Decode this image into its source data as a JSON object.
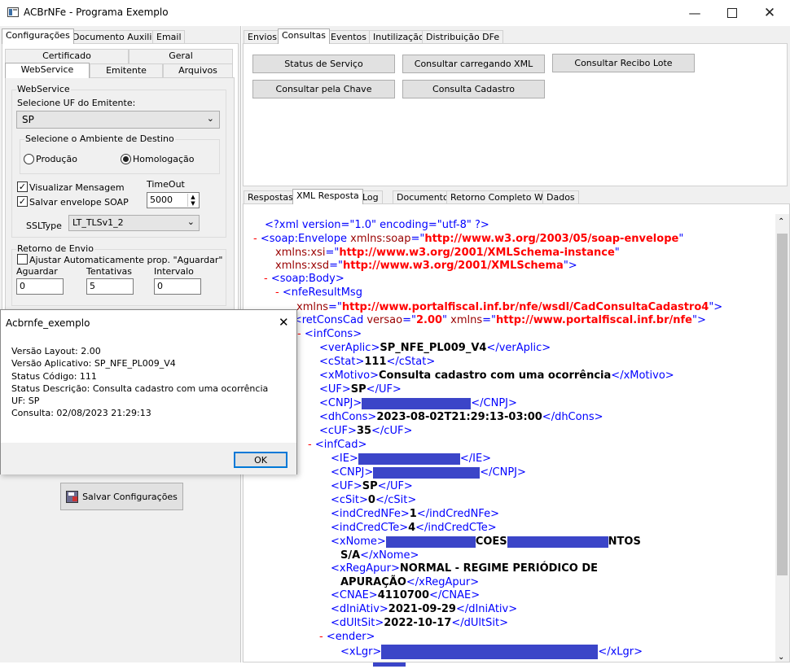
{
  "window": {
    "title": "ACBrNFe - Programa Exemplo"
  },
  "left_tabs": [
    "Configurações",
    "Documento Auxiliar",
    "Email"
  ],
  "sub_tabs_row1": [
    "Certificado",
    "Geral"
  ],
  "sub_tabs_row2": [
    "WebService",
    "Emitente",
    "Arquivos"
  ],
  "webservice": {
    "group_title": "WebService",
    "uf_label": "Selecione UF do Emitente:",
    "uf_value": "SP",
    "ambiente_title": "Selecione o Ambiente de Destino",
    "radio_producao": "Produção",
    "radio_homologacao": "Homologação",
    "chk_visualizar": "Visualizar Mensagem",
    "chk_salvar": "Salvar envelope SOAP",
    "timeout_label": "TimeOut",
    "timeout_value": "5000",
    "ssltype_label": "SSLType",
    "ssltype_value": "LT_TLSv1_2"
  },
  "retorno": {
    "group_title": "Retorno de Envio",
    "chk_ajustar": "Ajustar Automaticamente prop. \"Aguardar\"",
    "aguardar_label": "Aguardar",
    "aguardar_value": "0",
    "tentativas_label": "Tentativas",
    "tentativas_value": "5",
    "intervalo_label": "Intervalo",
    "intervalo_value": "0"
  },
  "save_button": "Salvar Configurações",
  "dialog": {
    "title": "Acbrnfe_exemplo",
    "lines": [
      "Versão Layout: 2.00",
      "Versão Aplicativo: SP_NFE_PL009_V4",
      "Status Código: 111",
      "Status Descrição: Consulta cadastro com uma ocorrência",
      "UF: SP",
      "Consulta: 02/08/2023 21:29:13"
    ],
    "ok": "OK"
  },
  "right_tabs": [
    "Envios",
    "Consultas",
    "Eventos",
    "Inutilização",
    "Distribuição DFe"
  ],
  "consultas_buttons": {
    "status": "Status de Serviço",
    "carregando_xml": "Consultar carregando XML",
    "recibo": "Consultar Recibo Lote",
    "chave": "Consultar pela Chave",
    "cadastro": "Consulta Cadastro"
  },
  "result_tabs": [
    "Respostas",
    "XML Resposta",
    "Log",
    "Documento",
    "Retorno Completo WS",
    "Dados"
  ],
  "xml": {
    "decl": "<?xml version=\"1.0\" encoding=\"utf-8\" ?>",
    "ns_soap": "http://www.w3.org/2003/05/soap-envelope",
    "ns_xsi": "http://www.w3.org/2001/XMLSchema-instance",
    "ns_xsd": "http://www.w3.org/2001/XMLSchema",
    "ns_wsdl": "http://www.portalfiscal.inf.br/nfe/wsdl/CadConsultaCadastro4",
    "versao": "2.00",
    "ns_nfe": "http://www.portalfiscal.inf.br/nfe",
    "verAplic": "SP_NFE_PL009_V4",
    "cStat": "111",
    "xMotivo": "Consulta cadastro com uma ocorrência",
    "uf": "SP",
    "dhCons": "2023-08-02T21:29:13-03:00",
    "cUF": "35",
    "sit": "0",
    "indCredNFe": "1",
    "indCredCTe": "4",
    "xNome_mid": "COES",
    "xNome_end": "NTOS",
    "xNome_line2": "S/A",
    "xRegApur_1": "NORMAL - REGIME PERIÓDICO DE",
    "xRegApur_2": "APURAÇÃO",
    "CNAE": "4110700",
    "dIniAtiv": "2021-09-29",
    "dUltSit": "2022-10-17"
  }
}
